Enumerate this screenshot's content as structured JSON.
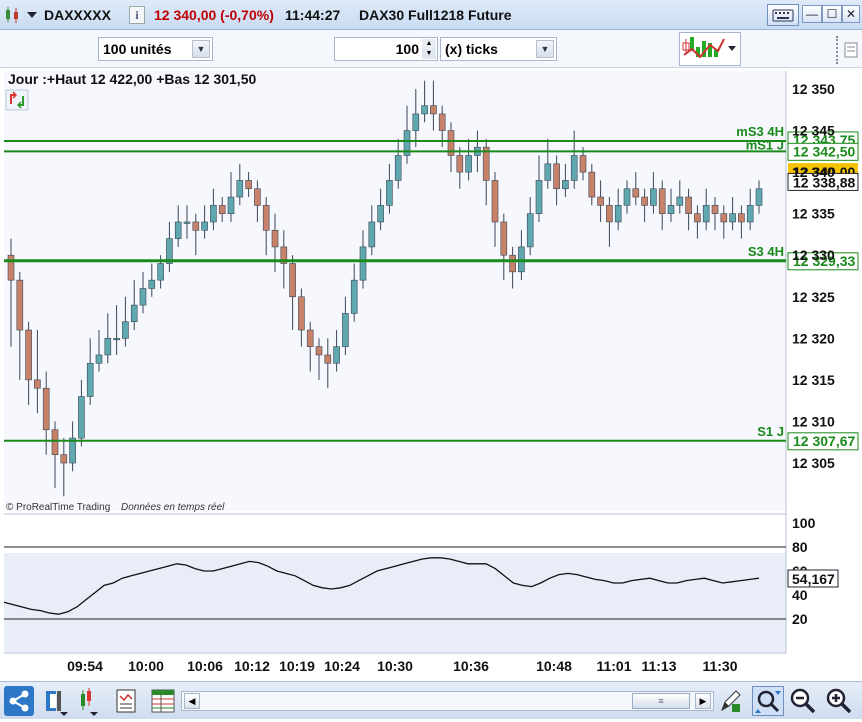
{
  "titlebar": {
    "symbol": "DAXXXXX",
    "info_icon": "i",
    "price_change": "12 340,00 (-0,70%)",
    "time": "11:44:27",
    "instrument": "DAX30 Full1218 Future",
    "price_color": "#c00000"
  },
  "toolbar": {
    "units_select": "100 unités",
    "ticks_value": "100",
    "ticks_select": "(x) ticks"
  },
  "chart": {
    "header_text": "Jour :+Haut 12 422,00 +Bas 12 301,50",
    "watermark_brand": "© ProRealTime Trading",
    "watermark_realtime": "Données en temps réel",
    "price_ticks": [
      "12 350",
      "12 345",
      "12 340",
      "12 335",
      "12 330",
      "12 325",
      "12 320",
      "12 315",
      "12 310",
      "12 305"
    ],
    "levels": [
      {
        "name": "mS3 4H",
        "value": "12 343,75"
      },
      {
        "name": "mS1 J",
        "value": "12 342,50"
      },
      {
        "name": "S3 4H",
        "value": "12 329,33"
      },
      {
        "name": "S1 J",
        "value": "12 307,67"
      }
    ],
    "current_price": "12 340,00",
    "last_label": "12 338,88",
    "time_labels": [
      "09:54",
      "10:00",
      "10:06",
      "10:12",
      "10:19",
      "10:24",
      "10:30",
      "10:36",
      "10:48",
      "11:01",
      "11:13",
      "11:30"
    ],
    "up_color": "#5fa8b0",
    "down_color": "#c9826a",
    "level_color": "#1a8a1a"
  },
  "oscillator": {
    "ticks": [
      "100",
      "80",
      "60",
      "40",
      "20"
    ],
    "current_value": "54,167",
    "upper_band": 80,
    "lower_band": 20
  },
  "chart_data": {
    "type": "candlestick",
    "ylim": [
      12301.5,
      12354
    ],
    "candles": [
      [
        12330,
        12327,
        12332,
        12319
      ],
      [
        12327,
        12321,
        12328,
        12315
      ],
      [
        12321,
        12315,
        12322,
        12312
      ],
      [
        12315,
        12314,
        12321,
        12311
      ],
      [
        12314,
        12309,
        12316,
        12306
      ],
      [
        12309,
        12306,
        12310,
        12302
      ],
      [
        12306,
        12305,
        12308,
        12301
      ],
      [
        12305,
        12308,
        12310,
        12304
      ],
      [
        12308,
        12313,
        12315,
        12307
      ],
      [
        12313,
        12317,
        12320,
        12312
      ],
      [
        12317,
        12318,
        12321,
        12316
      ],
      [
        12318,
        12320,
        12323,
        12317
      ],
      [
        12320,
        12320,
        12324,
        12318
      ],
      [
        12320,
        12322,
        12325,
        12319
      ],
      [
        12322,
        12324,
        12327,
        12321
      ],
      [
        12324,
        12326,
        12328,
        12323
      ],
      [
        12326,
        12327,
        12329,
        12325
      ],
      [
        12327,
        12329,
        12330,
        12326
      ],
      [
        12329,
        12332,
        12334,
        12328
      ],
      [
        12332,
        12334,
        12336,
        12331
      ],
      [
        12334,
        12334,
        12336,
        12332
      ],
      [
        12334,
        12333,
        12335,
        12330
      ],
      [
        12333,
        12334,
        12336,
        12332
      ],
      [
        12334,
        12336,
        12338,
        12333
      ],
      [
        12336,
        12335,
        12337,
        12334
      ],
      [
        12335,
        12337,
        12340,
        12334
      ],
      [
        12337,
        12339,
        12341,
        12336
      ],
      [
        12339,
        12338,
        12340,
        12337
      ],
      [
        12338,
        12336,
        12339,
        12334
      ],
      [
        12336,
        12333,
        12337,
        12330
      ],
      [
        12333,
        12331,
        12335,
        12328
      ],
      [
        12331,
        12329,
        12333,
        12326
      ],
      [
        12329,
        12325,
        12330,
        12321
      ],
      [
        12325,
        12321,
        12326,
        12319
      ],
      [
        12321,
        12319,
        12322,
        12316
      ],
      [
        12319,
        12318,
        12320,
        12315
      ],
      [
        12318,
        12317,
        12320,
        12314
      ],
      [
        12317,
        12319,
        12321,
        12316
      ],
      [
        12319,
        12323,
        12325,
        12318
      ],
      [
        12323,
        12327,
        12329,
        12322
      ],
      [
        12327,
        12331,
        12333,
        12326
      ],
      [
        12331,
        12334,
        12336,
        12330
      ],
      [
        12334,
        12336,
        12338,
        12333
      ],
      [
        12336,
        12339,
        12341,
        12335
      ],
      [
        12339,
        12342,
        12344,
        12338
      ],
      [
        12342,
        12345,
        12348,
        12341
      ],
      [
        12345,
        12347,
        12350,
        12343
      ],
      [
        12347,
        12348,
        12351,
        12346
      ],
      [
        12348,
        12347,
        12351,
        12345
      ],
      [
        12347,
        12345,
        12348,
        12343
      ],
      [
        12345,
        12342,
        12346,
        12340
      ],
      [
        12342,
        12340,
        12343,
        12338
      ],
      [
        12340,
        12342,
        12344,
        12339
      ],
      [
        12342,
        12343,
        12345,
        12340
      ],
      [
        12343,
        12339,
        12344,
        12336
      ],
      [
        12339,
        12334,
        12340,
        12331
      ],
      [
        12334,
        12330,
        12335,
        12327
      ],
      [
        12330,
        12328,
        12331,
        12326
      ],
      [
        12328,
        12331,
        12333,
        12327
      ],
      [
        12331,
        12335,
        12337,
        12330
      ],
      [
        12335,
        12339,
        12342,
        12334
      ],
      [
        12339,
        12341,
        12344,
        12338
      ],
      [
        12341,
        12338,
        12342,
        12336
      ],
      [
        12338,
        12339,
        12341,
        12337
      ],
      [
        12339,
        12342,
        12345,
        12338
      ],
      [
        12342,
        12340,
        12343,
        12339
      ],
      [
        12340,
        12337,
        12341,
        12336
      ],
      [
        12337,
        12336,
        12339,
        12334
      ],
      [
        12336,
        12334,
        12337,
        12331
      ],
      [
        12334,
        12336,
        12338,
        12333
      ],
      [
        12336,
        12338,
        12339,
        12335
      ],
      [
        12338,
        12337,
        12340,
        12336
      ],
      [
        12337,
        12336,
        12338,
        12334
      ],
      [
        12336,
        12338,
        12340,
        12335
      ],
      [
        12338,
        12335,
        12339,
        12333
      ],
      [
        12335,
        12336,
        12338,
        12334
      ],
      [
        12336,
        12337,
        12339,
        12335
      ],
      [
        12337,
        12335,
        12338,
        12333
      ],
      [
        12335,
        12334,
        12336,
        12332
      ],
      [
        12334,
        12336,
        12338,
        12333
      ],
      [
        12336,
        12335,
        12337,
        12333
      ],
      [
        12335,
        12334,
        12336,
        12332
      ],
      [
        12334,
        12335,
        12337,
        12333
      ],
      [
        12335,
        12334,
        12336,
        12332
      ],
      [
        12334,
        12336,
        12338,
        12333
      ],
      [
        12336,
        12338,
        12339,
        12335
      ]
    ],
    "oscillator_series": [
      34,
      32,
      30,
      28,
      27,
      25,
      24,
      26,
      30,
      36,
      42,
      48,
      50,
      54,
      56,
      58,
      60,
      62,
      64,
      66,
      65,
      62,
      60,
      60,
      62,
      64,
      66,
      68,
      67,
      64,
      60,
      58,
      56,
      52,
      48,
      46,
      45,
      46,
      48,
      52,
      56,
      60,
      62,
      64,
      66,
      68,
      70,
      71,
      71,
      70,
      68,
      66,
      66,
      66,
      62,
      56,
      50,
      48,
      47,
      50,
      54,
      57,
      58,
      57,
      55,
      53,
      52,
      50,
      50,
      52,
      53,
      54,
      52,
      50,
      50,
      52,
      53,
      54,
      52,
      50,
      51,
      52,
      53,
      54
    ]
  }
}
